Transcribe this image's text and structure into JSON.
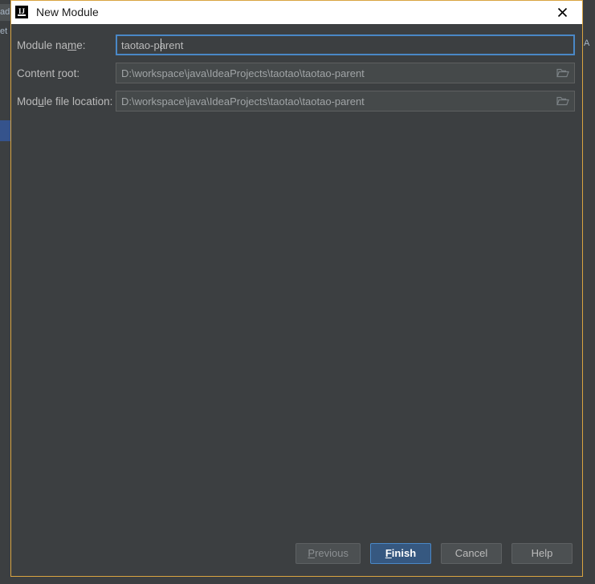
{
  "window": {
    "title": "New Module",
    "app_icon": "intellij-idea-icon",
    "icon_letters": "IJ",
    "close_icon": "close-icon",
    "border_color": "#d9a441",
    "titlebar_bg": "#ffffff",
    "body_bg": "#3c3f41"
  },
  "background": {
    "left_sliver_labels": [
      "ad",
      "et"
    ],
    "right_sliver_label": "A"
  },
  "form": {
    "fields": [
      {
        "id": "module-name",
        "label_before": "Module na",
        "label_mnemonic": "m",
        "label_after": "e:",
        "value": "taotao-parent",
        "focused": true,
        "has_browse": false
      },
      {
        "id": "content-root",
        "label_before": "Content ",
        "label_mnemonic": "r",
        "label_after": "oot:",
        "value": "D:\\workspace\\java\\IdeaProjects\\taotao\\taotao-parent",
        "focused": false,
        "has_browse": true,
        "browse_icon": "folder-icon"
      },
      {
        "id": "module-file-location",
        "label_before": "Mod",
        "label_mnemonic": "u",
        "label_after": "le file location:",
        "value": "D:\\workspace\\java\\IdeaProjects\\taotao\\taotao-parent",
        "focused": false,
        "has_browse": true,
        "browse_icon": "folder-icon"
      }
    ]
  },
  "buttons": {
    "previous": {
      "before": "",
      "mnemonic": "P",
      "after": "revious"
    },
    "finish": {
      "before": "",
      "mnemonic": "F",
      "after": "inish"
    },
    "cancel": {
      "before": "Cancel",
      "mnemonic": "",
      "after": ""
    },
    "help": {
      "before": "Help",
      "mnemonic": "",
      "after": ""
    }
  },
  "colors": {
    "accent_border": "#d9a441",
    "focus_blue": "#4a88c7",
    "primary_button": "#365880",
    "text": "#bbbbbb",
    "path_text": "#a0a4a6"
  }
}
